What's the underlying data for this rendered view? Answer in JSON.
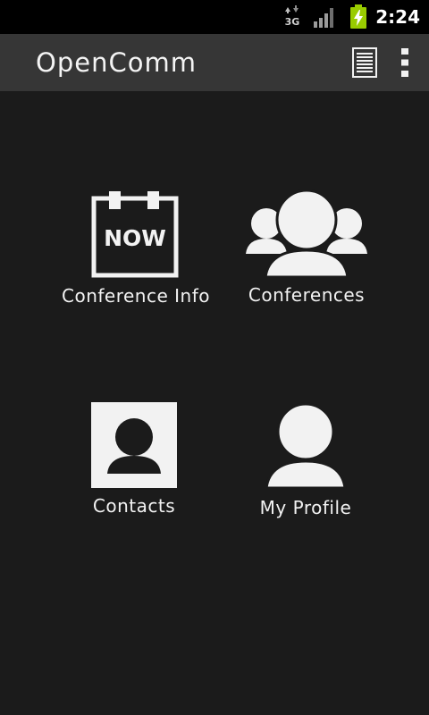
{
  "status_bar": {
    "time": "2:24",
    "network_type": "3G",
    "icons": [
      "data-arrows-3g-icon",
      "signal-strength-icon",
      "battery-charging-icon"
    ],
    "battery_color": "#99cc00"
  },
  "action_bar": {
    "title": "OpenComm",
    "actions": [
      {
        "name": "list-view-icon"
      },
      {
        "name": "overflow-menu-icon"
      }
    ]
  },
  "tiles": [
    {
      "label": "Conference Info",
      "icon": "calendar-now-icon",
      "icon_text": "NOW"
    },
    {
      "label": "Conferences",
      "icon": "people-group-icon"
    },
    {
      "label": "Contacts",
      "icon": "contact-card-icon"
    },
    {
      "label": "My Profile",
      "icon": "person-icon"
    }
  ],
  "colors": {
    "background": "#1b1b1b",
    "action_bar": "#363636",
    "status_bar": "#000000",
    "foreground": "#f2f2f2"
  }
}
